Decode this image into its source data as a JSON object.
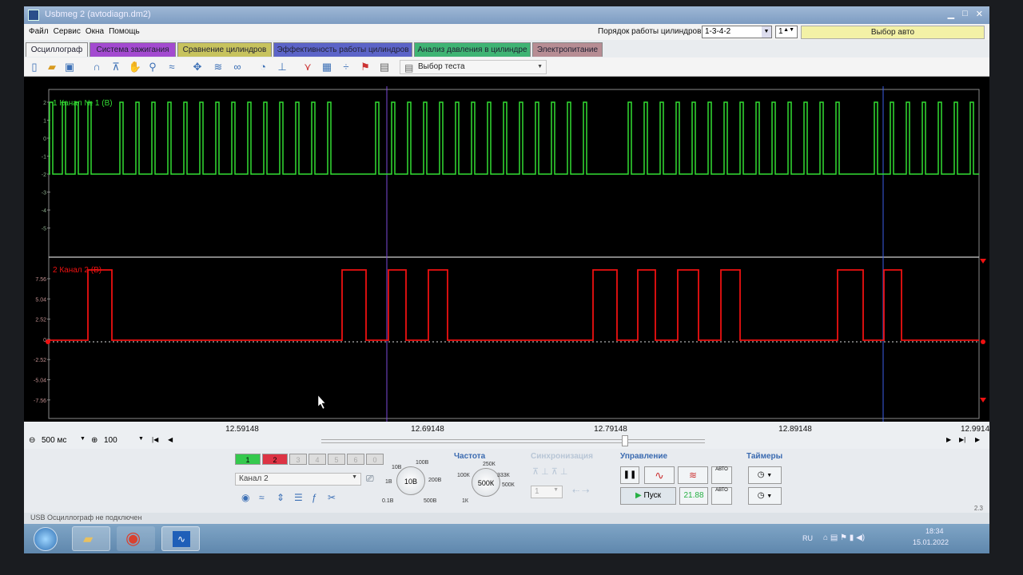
{
  "window": {
    "title": "Usbmeg 2 (avtodiagn.dm2)"
  },
  "menu": [
    "Файл",
    "Сервис",
    "Окна",
    "Помощь"
  ],
  "firing": {
    "label": "Порядок работы цилиндров",
    "order": "1-3-4-2",
    "cylinder": "1",
    "auto_button": "Выбор авто"
  },
  "tabs": [
    {
      "label": "Осциллограф",
      "color": "#f4f4f4"
    },
    {
      "label": "Система зажигания",
      "color": "#a34ad0"
    },
    {
      "label": "Сравнение цилиндров",
      "color": "#c7c35e"
    },
    {
      "label": "Эффективность работы цилиндров",
      "color": "#5c64c8"
    },
    {
      "label": "Анализ давления в цилиндре",
      "color": "#3fb474"
    },
    {
      "label": "Электропитание",
      "color": "#b78d94"
    }
  ],
  "toolbar": {
    "test_select": "Выбор теста"
  },
  "channels": [
    {
      "label": "1 Канал № 1 (В)",
      "color": "#33dd33",
      "ticks": [
        "2",
        "1",
        "0",
        "-1",
        "-2",
        "-3",
        "-4",
        "-5"
      ]
    },
    {
      "label": "2 Канал 2 (В)",
      "color": "#ee1111",
      "ticks": [
        "7.56",
        "5.04",
        "2.52",
        "0",
        "-2.52",
        "-5.04",
        "-7.56"
      ]
    }
  ],
  "time_axis": [
    "12.59148",
    "12.69148",
    "12.79148",
    "12.89148",
    "12.9914"
  ],
  "view": {
    "timebase": "500 мс",
    "zoom": "100"
  },
  "channel_buttons": [
    "1",
    "2",
    "3",
    "4",
    "5",
    "6",
    "0"
  ],
  "control": {
    "channel_select": "Канал 2",
    "voltage_knob_value": "10В",
    "voltage_labels": [
      "10В",
      "100В",
      "200В",
      "500В",
      "0.1В",
      "1В"
    ],
    "freq_title": "Частота",
    "freq_knob_value": "500К",
    "freq_labels": [
      "250К",
      "333К",
      "100К",
      "500К",
      "1К"
    ],
    "sync_title": "Синхронизация",
    "sync_value": "1",
    "control_title": "Управление",
    "start_label": "Пуск",
    "rpm_value": "21.88",
    "auto_label": "АВТО",
    "timers_title": "Таймеры"
  },
  "status": {
    "text": "USB Осциллограф не подключен",
    "version": "2.3"
  },
  "taskbar": {
    "lang": "RU",
    "time": "18:34",
    "date": "15.01.2022"
  }
}
